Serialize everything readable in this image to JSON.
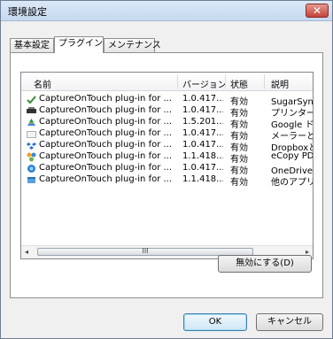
{
  "window": {
    "title": "環境設定",
    "close_glyph": "✕"
  },
  "tabs": [
    {
      "label": "基本設定",
      "active": false
    },
    {
      "label": "プラグイン",
      "active": true
    },
    {
      "label": "メンテナンス",
      "active": false
    }
  ],
  "table": {
    "columns": [
      "名前",
      "バージョン",
      "状態",
      "説明"
    ],
    "rows": [
      {
        "icon": "sugarsync-icon",
        "name": "CaptureOnTouch plug-in for ...",
        "version": "1.0.417...",
        "status": "有効",
        "desc": "SugarSyncと"
      },
      {
        "icon": "printer-icon",
        "name": "CaptureOnTouch plug-in for ...",
        "version": "1.0.417...",
        "status": "有効",
        "desc": "プリンターとCa"
      },
      {
        "icon": "google-drive-icon",
        "name": "CaptureOnTouch plug-in for ...",
        "version": "1.5.201...",
        "status": "有効",
        "desc": "Google ドライ"
      },
      {
        "icon": "mail-icon",
        "name": "CaptureOnTouch plug-in for ...",
        "version": "1.0.417...",
        "status": "有効",
        "desc": "メーラーとCapt"
      },
      {
        "icon": "dropbox-icon",
        "name": "CaptureOnTouch plug-in for ...",
        "version": "1.0.417...",
        "status": "有効",
        "desc": "DropboxとCa"
      },
      {
        "icon": "ecopy-icon",
        "name": "CaptureOnTouch plug-in for ...",
        "version": "1.1.418...",
        "status": "有効",
        "desc": "eCopy PDF"
      },
      {
        "icon": "onedrive-icon",
        "name": "CaptureOnTouch plug-in for ...",
        "version": "1.0.417...",
        "status": "有効",
        "desc": "OneDriveとC"
      },
      {
        "icon": "application-icon",
        "name": "CaptureOnTouch plug-in for ...",
        "version": "1.1.418...",
        "status": "有効",
        "desc": "他のアプリケー"
      }
    ]
  },
  "scrollbar": {
    "left_arrow": "◂",
    "right_arrow": "▸",
    "grip": "III"
  },
  "buttons": {
    "disable": "無効にする(D)",
    "ok": "OK",
    "cancel": "キャンセル"
  }
}
